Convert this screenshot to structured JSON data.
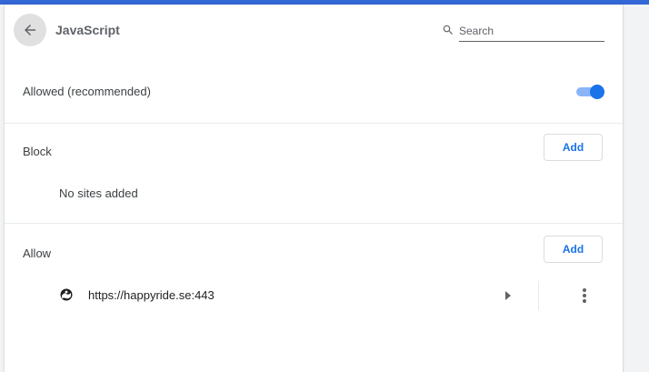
{
  "header": {
    "title": "JavaScript",
    "back_icon": "arrow-back-icon",
    "search": {
      "placeholder": "Search",
      "value": "",
      "icon": "search-icon"
    }
  },
  "default_setting": {
    "label": "Allowed (recommended)",
    "enabled": true
  },
  "block": {
    "label": "Block",
    "add_label": "Add",
    "empty_text": "No sites added"
  },
  "allow": {
    "label": "Allow",
    "add_label": "Add",
    "sites": [
      {
        "url": "https://happyride.se:443",
        "icon": "site-favicon-icon"
      }
    ]
  },
  "colors": {
    "accent": "#1a73e8",
    "topbar": "#3367d6",
    "toggle_track": "#8ab4f8"
  }
}
